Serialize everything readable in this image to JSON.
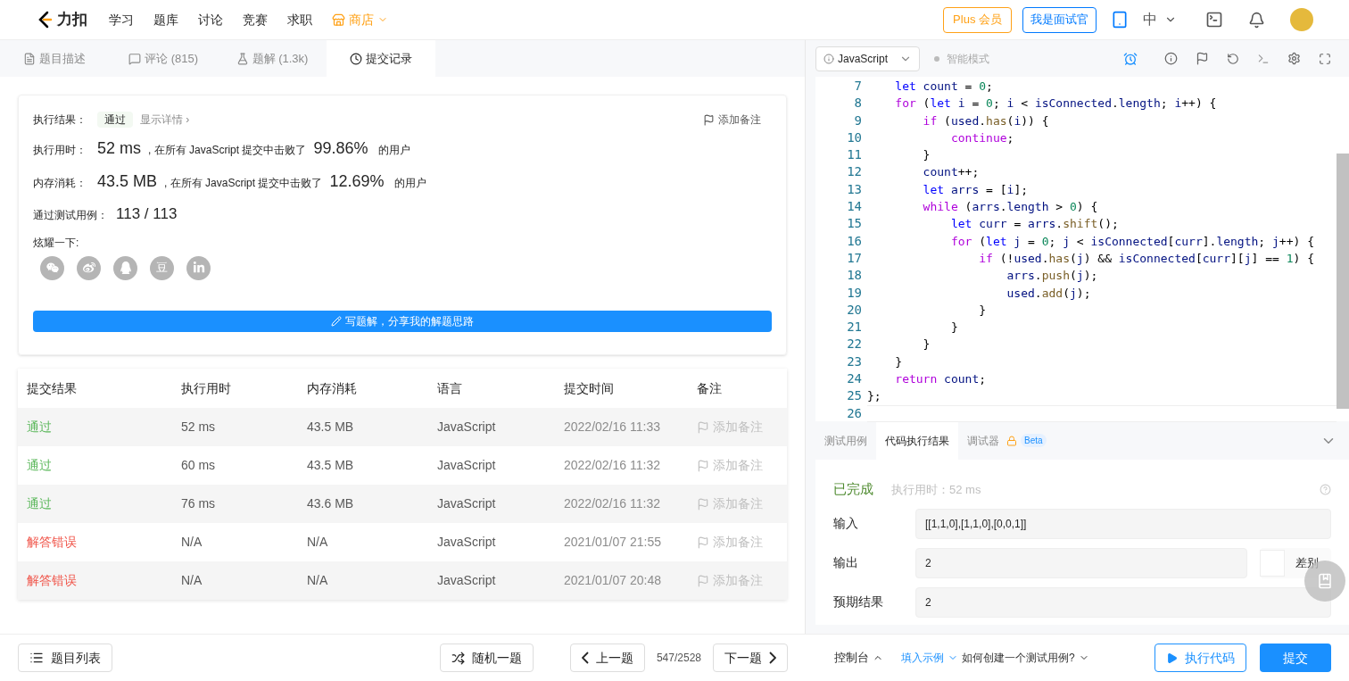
{
  "nav": {
    "logo": "力扣",
    "items": [
      "学习",
      "题库",
      "讨论",
      "竞赛",
      "求职"
    ],
    "shop": "商店",
    "plus": "Plus 会员",
    "interviewer": "我是面试官",
    "lang": "中"
  },
  "tabs": [
    {
      "label": "题目描述",
      "kind": "desc",
      "selected": false
    },
    {
      "label": "评论 (815)",
      "kind": "comments",
      "selected": false
    },
    {
      "label": "题解 (1.3k)",
      "kind": "solutions",
      "selected": false
    },
    {
      "label": "提交记录",
      "kind": "history",
      "selected": true
    }
  ],
  "result": {
    "status_label": "执行结果：",
    "status": "通过",
    "details": "显示详情 ›",
    "note_button": "添加备注",
    "stats": [
      {
        "label": "执行用时：",
        "value": "52 ms",
        "text": ", 在所有 JavaScript 提交中击败了",
        "percent": "99.86%",
        "suffix": "的用户"
      },
      {
        "label": "内存消耗：",
        "value": "43.5 MB",
        "text": ", 在所有 JavaScript 提交中击败了",
        "percent": "12.69%",
        "suffix": "的用户"
      }
    ],
    "testcases": {
      "label": "通过测试用例：",
      "value": "113 / 113"
    },
    "share_label": "炫耀一下:",
    "share": [
      {
        "kind": "wechat"
      },
      {
        "kind": "weibo"
      },
      {
        "kind": "qq"
      },
      {
        "kind": "douban",
        "glyph": "豆"
      },
      {
        "kind": "linkedin"
      }
    ],
    "write_button": "写题解，分享我的解题思路"
  },
  "submissions": {
    "columns": [
      "提交结果",
      "执行用时",
      "内存消耗",
      "语言",
      "提交时间",
      "备注"
    ],
    "rows": [
      {
        "status": "通过",
        "kind": "accepted",
        "runtime": "52 ms",
        "memory": "43.5 MB",
        "language": "JavaScript",
        "time": "2022/02/16 11:33",
        "note": "添加备注"
      },
      {
        "status": "通过",
        "kind": "accepted",
        "runtime": "60 ms",
        "memory": "43.5 MB",
        "language": "JavaScript",
        "time": "2022/02/16 11:32",
        "note": "添加备注"
      },
      {
        "status": "通过",
        "kind": "accepted",
        "runtime": "76 ms",
        "memory": "43.6 MB",
        "language": "JavaScript",
        "time": "2022/02/16 11:32",
        "note": "添加备注"
      },
      {
        "status": "解答错误",
        "kind": "wrong",
        "runtime": "N/A",
        "memory": "N/A",
        "language": "JavaScript",
        "time": "2021/01/07 21:55",
        "note": "添加备注"
      },
      {
        "status": "解答错误",
        "kind": "wrong",
        "runtime": "N/A",
        "memory": "N/A",
        "language": "JavaScript",
        "time": "2021/01/07 20:48",
        "note": "添加备注"
      }
    ]
  },
  "editor": {
    "language": "JavaScript",
    "mode": "智能模式",
    "lines": [
      {
        "n": "7",
        "tokens": [
          {
            "kind": "decl",
            "text": "    let"
          },
          {
            "kind": "id",
            "text": " count "
          },
          {
            "kind": "p",
            "text": "= "
          },
          {
            "kind": "num",
            "text": "0"
          },
          {
            "kind": "p",
            "text": ";"
          }
        ]
      },
      {
        "n": "8",
        "tokens": [
          {
            "kind": "ctrl",
            "text": "    for"
          },
          {
            "kind": "p",
            "text": " ("
          },
          {
            "kind": "decl",
            "text": "let"
          },
          {
            "kind": "id",
            "text": " i "
          },
          {
            "kind": "p",
            "text": "= "
          },
          {
            "kind": "num",
            "text": "0"
          },
          {
            "kind": "p",
            "text": "; "
          },
          {
            "kind": "id",
            "text": "i "
          },
          {
            "kind": "p",
            "text": "< "
          },
          {
            "kind": "id",
            "text": "isConnected"
          },
          {
            "kind": "p",
            "text": "."
          },
          {
            "kind": "id",
            "text": "length"
          },
          {
            "kind": "p",
            "text": "; "
          },
          {
            "kind": "id",
            "text": "i"
          },
          {
            "kind": "p",
            "text": "++) {"
          }
        ]
      },
      {
        "n": "9",
        "tokens": [
          {
            "kind": "ctrl",
            "text": "        if"
          },
          {
            "kind": "p",
            "text": " ("
          },
          {
            "kind": "id",
            "text": "used"
          },
          {
            "kind": "p",
            "text": "."
          },
          {
            "kind": "fn",
            "text": "has"
          },
          {
            "kind": "p",
            "text": "("
          },
          {
            "kind": "id",
            "text": "i"
          },
          {
            "kind": "p",
            "text": ")) {"
          }
        ]
      },
      {
        "n": "10",
        "tokens": [
          {
            "kind": "ctrl",
            "text": "            continue"
          },
          {
            "kind": "p",
            "text": ";"
          }
        ]
      },
      {
        "n": "11",
        "tokens": [
          {
            "kind": "p",
            "text": "        }"
          }
        ]
      },
      {
        "n": "12",
        "tokens": [
          {
            "kind": "id",
            "text": "        count"
          },
          {
            "kind": "p",
            "text": "++;"
          }
        ]
      },
      {
        "n": "13",
        "tokens": [
          {
            "kind": "decl",
            "text": "        let"
          },
          {
            "kind": "id",
            "text": " arrs "
          },
          {
            "kind": "p",
            "text": "= ["
          },
          {
            "kind": "id",
            "text": "i"
          },
          {
            "kind": "p",
            "text": "];"
          }
        ]
      },
      {
        "n": "14",
        "tokens": [
          {
            "kind": "ctrl",
            "text": "        while"
          },
          {
            "kind": "p",
            "text": " ("
          },
          {
            "kind": "id",
            "text": "arrs"
          },
          {
            "kind": "p",
            "text": "."
          },
          {
            "kind": "id",
            "text": "length"
          },
          {
            "kind": "p",
            "text": " > "
          },
          {
            "kind": "num",
            "text": "0"
          },
          {
            "kind": "p",
            "text": ") {"
          }
        ]
      },
      {
        "n": "15",
        "tokens": [
          {
            "kind": "decl",
            "text": "            let"
          },
          {
            "kind": "id",
            "text": " curr "
          },
          {
            "kind": "p",
            "text": "= "
          },
          {
            "kind": "id",
            "text": "arrs"
          },
          {
            "kind": "p",
            "text": "."
          },
          {
            "kind": "fn",
            "text": "shift"
          },
          {
            "kind": "p",
            "text": "();"
          }
        ]
      },
      {
        "n": "16",
        "tokens": [
          {
            "kind": "ctrl",
            "text": "            for"
          },
          {
            "kind": "p",
            "text": " ("
          },
          {
            "kind": "decl",
            "text": "let"
          },
          {
            "kind": "id",
            "text": " j "
          },
          {
            "kind": "p",
            "text": "= "
          },
          {
            "kind": "num",
            "text": "0"
          },
          {
            "kind": "p",
            "text": "; "
          },
          {
            "kind": "id",
            "text": "j "
          },
          {
            "kind": "p",
            "text": "< "
          },
          {
            "kind": "id",
            "text": "isConnected"
          },
          {
            "kind": "p",
            "text": "["
          },
          {
            "kind": "id",
            "text": "curr"
          },
          {
            "kind": "p",
            "text": "]."
          },
          {
            "kind": "id",
            "text": "length"
          },
          {
            "kind": "p",
            "text": "; "
          },
          {
            "kind": "id",
            "text": "j"
          },
          {
            "kind": "p",
            "text": "++) {"
          }
        ]
      },
      {
        "n": "17",
        "tokens": [
          {
            "kind": "ctrl",
            "text": "                if"
          },
          {
            "kind": "p",
            "text": " (!"
          },
          {
            "kind": "id",
            "text": "used"
          },
          {
            "kind": "p",
            "text": "."
          },
          {
            "kind": "fn",
            "text": "has"
          },
          {
            "kind": "p",
            "text": "("
          },
          {
            "kind": "id",
            "text": "j"
          },
          {
            "kind": "p",
            "text": ") && "
          },
          {
            "kind": "id",
            "text": "isConnected"
          },
          {
            "kind": "p",
            "text": "["
          },
          {
            "kind": "id",
            "text": "curr"
          },
          {
            "kind": "p",
            "text": "]["
          },
          {
            "kind": "id",
            "text": "j"
          },
          {
            "kind": "p",
            "text": "] == "
          },
          {
            "kind": "num",
            "text": "1"
          },
          {
            "kind": "p",
            "text": ") {"
          }
        ]
      },
      {
        "n": "18",
        "tokens": [
          {
            "kind": "id",
            "text": "                    arrs"
          },
          {
            "kind": "p",
            "text": "."
          },
          {
            "kind": "fn",
            "text": "push"
          },
          {
            "kind": "p",
            "text": "("
          },
          {
            "kind": "id",
            "text": "j"
          },
          {
            "kind": "p",
            "text": ");"
          }
        ]
      },
      {
        "n": "19",
        "tokens": [
          {
            "kind": "id",
            "text": "                    used"
          },
          {
            "kind": "p",
            "text": "."
          },
          {
            "kind": "fn",
            "text": "add"
          },
          {
            "kind": "p",
            "text": "("
          },
          {
            "kind": "id",
            "text": "j"
          },
          {
            "kind": "p",
            "text": ");"
          }
        ]
      },
      {
        "n": "20",
        "tokens": [
          {
            "kind": "p",
            "text": "                }"
          }
        ]
      },
      {
        "n": "21",
        "tokens": [
          {
            "kind": "p",
            "text": "            }"
          }
        ]
      },
      {
        "n": "22",
        "tokens": [
          {
            "kind": "p",
            "text": "        }"
          }
        ]
      },
      {
        "n": "23",
        "tokens": [
          {
            "kind": "p",
            "text": "    }"
          }
        ]
      },
      {
        "n": "24",
        "tokens": [
          {
            "kind": "ctrl",
            "text": "    return"
          },
          {
            "kind": "id",
            "text": " count"
          },
          {
            "kind": "p",
            "text": ";"
          }
        ]
      },
      {
        "n": "25",
        "tokens": [
          {
            "kind": "p",
            "text": "};"
          }
        ]
      },
      {
        "n": "26"
      }
    ]
  },
  "console": {
    "tabs": [
      {
        "label": "测试用例",
        "selected": false
      },
      {
        "label": "代码执行结果",
        "selected": true
      },
      {
        "label": "调试器",
        "selected": false,
        "locked": true,
        "badge": "Beta"
      }
    ],
    "status": "已完成",
    "runtime": "执行用时：52 ms",
    "fields": [
      {
        "label": "输入",
        "value": "[[1,1,0],[1,1,0],[0,0,1]]"
      },
      {
        "label": "输出",
        "value": "2",
        "diff": "差别"
      },
      {
        "label": "预期结果",
        "value": "2"
      }
    ]
  },
  "bottom": {
    "problem_list": "题目列表",
    "random": "随机一题",
    "prev": "上一题",
    "counter": "547/2528",
    "next": "下一题",
    "console": "控制台",
    "fill_example": "填入示例",
    "how_to": "如何创建一个测试用例?",
    "run": "执行代码",
    "submit": "提交"
  }
}
